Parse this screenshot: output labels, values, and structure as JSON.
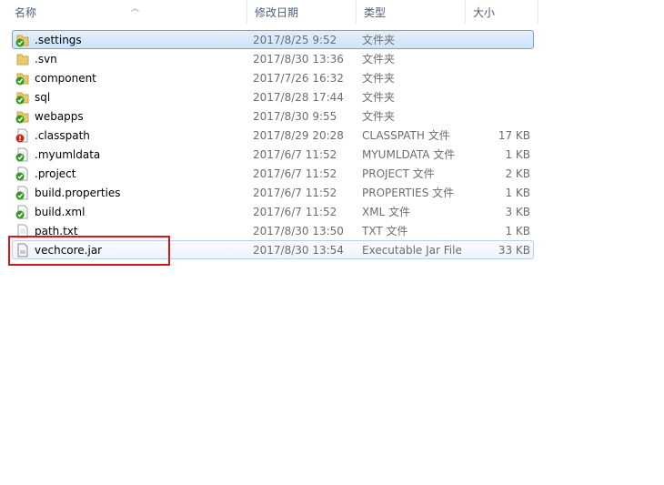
{
  "columns": {
    "name": "名称",
    "date": "修改日期",
    "type": "类型",
    "size": "大小"
  },
  "files": [
    {
      "name": ".settings",
      "date": "2017/8/25 9:52",
      "type": "文件夹",
      "size": "",
      "icon": "folder-svn-ok-icon",
      "state": "selected"
    },
    {
      "name": ".svn",
      "date": "2017/8/30 13:36",
      "type": "文件夹",
      "size": "",
      "icon": "folder-icon"
    },
    {
      "name": "component",
      "date": "2017/7/26 16:32",
      "type": "文件夹",
      "size": "",
      "icon": "folder-svn-ok-icon"
    },
    {
      "name": "sql",
      "date": "2017/8/28 17:44",
      "type": "文件夹",
      "size": "",
      "icon": "folder-svn-ok-icon"
    },
    {
      "name": "webapps",
      "date": "2017/8/30 9:55",
      "type": "文件夹",
      "size": "",
      "icon": "folder-svn-ok-icon"
    },
    {
      "name": ".classpath",
      "date": "2017/8/29 20:28",
      "type": "CLASSPATH 文件",
      "size": "17 KB",
      "icon": "file-svn-modified-icon"
    },
    {
      "name": ".myumldata",
      "date": "2017/6/7 11:52",
      "type": "MYUMLDATA 文件",
      "size": "1 KB",
      "icon": "file-svn-ok-icon"
    },
    {
      "name": ".project",
      "date": "2017/6/7 11:52",
      "type": "PROJECT 文件",
      "size": "2 KB",
      "icon": "file-svn-ok-icon"
    },
    {
      "name": "build.properties",
      "date": "2017/6/7 11:52",
      "type": "PROPERTIES 文件",
      "size": "1 KB",
      "icon": "file-svn-ok-icon"
    },
    {
      "name": "build.xml",
      "date": "2017/6/7 11:52",
      "type": "XML 文件",
      "size": "3 KB",
      "icon": "file-svn-ok-icon"
    },
    {
      "name": "path.txt",
      "date": "2017/8/30 13:50",
      "type": "TXT 文件",
      "size": "1 KB",
      "icon": "text-file-icon"
    },
    {
      "name": "vechcore.jar",
      "date": "2017/8/30 13:54",
      "type": "Executable Jar File",
      "size": "33 KB",
      "icon": "jar-file-icon",
      "state": "hover"
    }
  ],
  "colors": {
    "selection": "#cfe3fb",
    "highlight_box": "#d9161c",
    "svn_ok": "#2f9a1e",
    "svn_modified": "#d0261a"
  }
}
